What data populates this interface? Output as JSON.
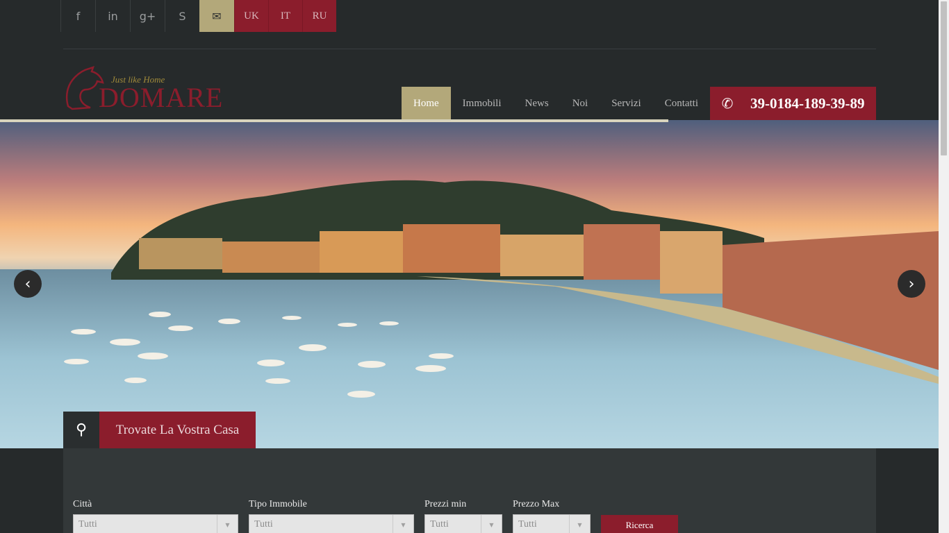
{
  "social": [
    {
      "icon": "facebook-icon",
      "glyph": "f"
    },
    {
      "icon": "linkedin-icon",
      "glyph": "in"
    },
    {
      "icon": "google-plus-icon",
      "glyph": "g+"
    },
    {
      "icon": "skype-icon",
      "glyph": "S"
    },
    {
      "icon": "mail-icon",
      "glyph": "✉"
    }
  ],
  "languages": [
    "UK",
    "IT",
    "RU"
  ],
  "logo": {
    "tagline": "Just like Home",
    "name": "DOMARE"
  },
  "nav": {
    "items": [
      "Home",
      "Immobili",
      "News",
      "Noi",
      "Servizi",
      "Contatti"
    ],
    "active": "Home"
  },
  "phone": {
    "icon": "phone-icon",
    "number": "39-0184-189-39-89"
  },
  "hero": {
    "prev_icon": "chevron-left-icon",
    "next_icon": "chevron-right-icon"
  },
  "search": {
    "tab_label": "Trovate La Vostra Casa",
    "icon": "search-icon",
    "fields": [
      {
        "label": "Città",
        "value": "Tutti"
      },
      {
        "label": "Tipo Immobile",
        "value": "Tutti"
      },
      {
        "label": "Prezzi min",
        "value": "Tutti"
      },
      {
        "label": "Prezzo Max",
        "value": "Tutti"
      }
    ],
    "button": "Ricerca"
  },
  "colors": {
    "brand": "#8b1d2c",
    "accent": "#b3a87a",
    "background": "#262a2b"
  }
}
